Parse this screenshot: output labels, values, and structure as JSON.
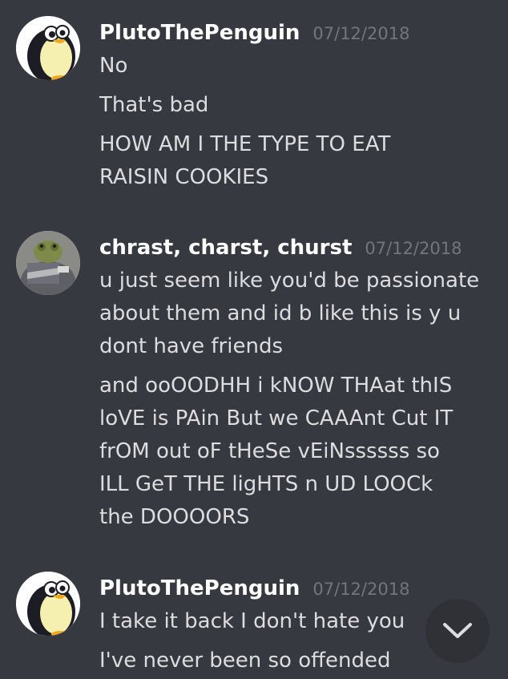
{
  "messages": [
    {
      "username": "PlutoThePenguin",
      "timestamp": "07/12/2018",
      "avatar_icon": "penguin-avatar-icon",
      "lines": [
        "No",
        "That's bad",
        "HOW AM I THE TYPE TO EAT",
        "RAISIN COOKIES"
      ]
    },
    {
      "username": "chrast, charst, churst",
      "timestamp": "07/12/2018",
      "avatar_icon": "frog-photo-avatar-icon",
      "lines": [
        "u just seem like you'd be passionate",
        "about them and id b like this is y u",
        "dont have friends",
        "and ooOODHH i kNOW THAat thIS",
        "loVE is PAin But we CAAAnt Cut IT",
        "frOM out oF tHeSe vEiNssssss so",
        "ILL GeT THE ligHTS n UD LOOCk",
        "the DOOOORS"
      ]
    },
    {
      "username": "PlutoThePenguin",
      "timestamp": "07/12/2018",
      "avatar_icon": "penguin-avatar-icon",
      "lines": [
        "I take it back I don't hate you",
        "I've never been so offended"
      ]
    }
  ],
  "jump_button_icon": "chevron-down-icon",
  "colors": {
    "background": "#36393f",
    "username": "#ffffff",
    "message_text": "#dcddde",
    "timestamp": "#72767d",
    "jump_button": "#2f3136"
  }
}
